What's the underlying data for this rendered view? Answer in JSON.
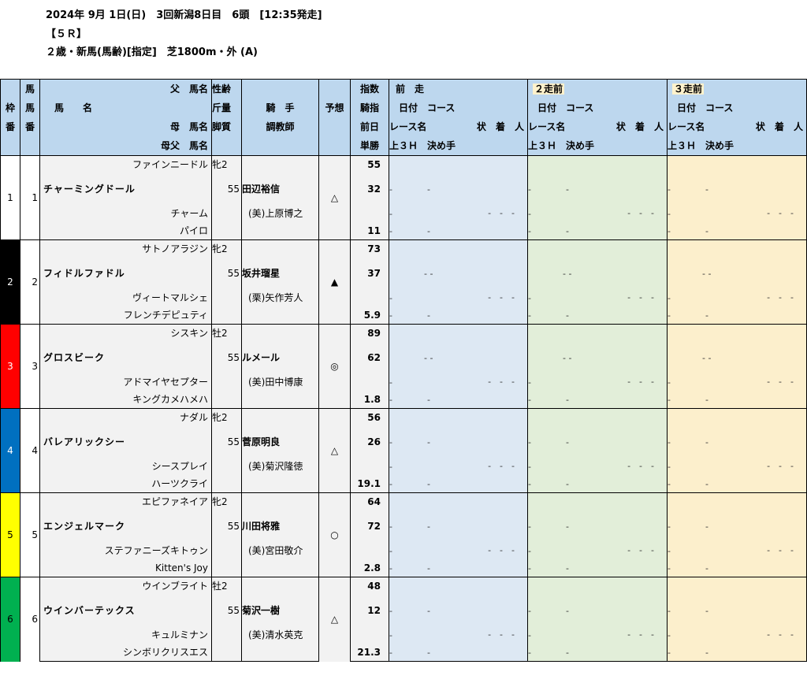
{
  "header": {
    "line1": "2024年 9月 1日(日)　3回新潟8日目　6頭　[12:35発走]",
    "line2": "【５Ｒ】",
    "line3": "２歳・新馬(馬齢)[指定]　芝1800m・外 (A)"
  },
  "columns": {
    "waku": "枠",
    "ban": "番",
    "uma": "馬",
    "uma2": "番",
    "father": "父　馬名",
    "name_label": "馬　　名",
    "mother": "母　馬名",
    "mothers_father": "母父　馬名",
    "sex_age": "性齢",
    "weight": "斤量",
    "style": "脚質",
    "jockey": "騎　手",
    "trainer": "調教師",
    "prediction": "予想",
    "index": "指数",
    "jockey_index": "騎指",
    "prev_day": "前日",
    "win_odds": "単勝",
    "prev1": "前　走",
    "prev2": "２走前",
    "prev3": "３走前",
    "date_course": "日付　コース",
    "race_name": "レース名",
    "state": "状",
    "finish": "着",
    "pop": "人",
    "last3f": "上３Ｈ",
    "decisive": "決め手"
  },
  "horses": [
    {
      "waku": "1",
      "ban": "1",
      "father": "ファインニードル",
      "name": "チャーミングドール",
      "mother": "チャーム",
      "mothers_father": "パイロ",
      "sex_age": "牝2",
      "weight": "55",
      "jockey": "田辺裕信",
      "trainer": "(美)上原博之",
      "mark": "△",
      "index": "55",
      "jockey_index": "32",
      "odds": "11",
      "waku_color": "#ffffff",
      "waku_text": "#000000",
      "prev_style": "a"
    },
    {
      "waku": "2",
      "ban": "2",
      "father": "サトノアラジン",
      "name": "フィドルファドル",
      "mother": "ヴィートマルシェ",
      "mothers_father": "フレンチデピュティ",
      "sex_age": "牝2",
      "weight": "55",
      "jockey": "坂井瑠星",
      "trainer": "(栗)矢作芳人",
      "mark": "▲",
      "index": "73",
      "jockey_index": "37",
      "odds": "5.9",
      "waku_color": "#000000",
      "waku_text": "#ffffff",
      "prev_style": "b"
    },
    {
      "waku": "3",
      "ban": "3",
      "father": "シスキン",
      "name": "グロスビーク",
      "mother": "アドマイヤセプター",
      "mothers_father": "キングカメハメハ",
      "sex_age": "牡2",
      "weight": "55",
      "jockey": "ルメール",
      "trainer": "(美)田中博康",
      "mark": "◎",
      "index": "89",
      "jockey_index": "62",
      "odds": "1.8",
      "waku_color": "#ff0000",
      "waku_text": "#ffffff",
      "prev_style": "b"
    },
    {
      "waku": "4",
      "ban": "4",
      "father": "ナダル",
      "name": "バレアリックシー",
      "mother": "シースプレイ",
      "mothers_father": "ハーツクライ",
      "sex_age": "牝2",
      "weight": "55",
      "jockey": "菅原明良",
      "trainer": "(美)菊沢隆徳",
      "mark": "△",
      "index": "56",
      "jockey_index": "26",
      "odds": "19.1",
      "waku_color": "#0070c0",
      "waku_text": "#ffffff",
      "prev_style": "a"
    },
    {
      "waku": "5",
      "ban": "5",
      "father": "エピファネイア",
      "name": "エンジェルマーク",
      "mother": "ステファニーズキトゥン",
      "mothers_father": "Kitten's Joy",
      "sex_age": "牝2",
      "weight": "55",
      "jockey": "川田将雅",
      "trainer": "(美)宮田敬介",
      "mark": "○",
      "index": "64",
      "jockey_index": "72",
      "odds": "2.8",
      "waku_color": "#ffff00",
      "waku_text": "#000000",
      "prev_style": "a"
    },
    {
      "waku": "6",
      "ban": "6",
      "father": "ウインブライト",
      "name": "ウインバーテックス",
      "mother": "キュルミナン",
      "mothers_father": "シンボリクリスエス",
      "sex_age": "牡2",
      "weight": "55",
      "jockey": "菊沢一樹",
      "trainer": "(美)清水英克",
      "mark": "△",
      "index": "48",
      "jockey_index": "12",
      "odds": "21.3",
      "waku_color": "#00b050",
      "waku_text": "#000000",
      "prev_style": "a"
    }
  ],
  "placeholders": {
    "dash": "-",
    "dash_a": "-　　　　-",
    "dash_b": "- -",
    "dash_three": "-　-　-"
  }
}
